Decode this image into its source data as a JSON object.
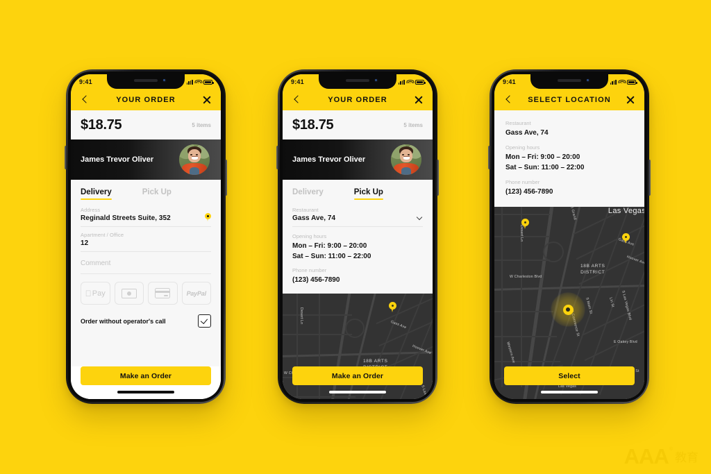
{
  "page": {
    "background_color": "#FDD30D",
    "watermark": {
      "brand": "AAA",
      "reg": "®",
      "cn": "教育"
    }
  },
  "status_bar": {
    "time": "9:41",
    "signal": "signal-icon",
    "wifi": "wifi-icon",
    "battery": "battery-icon"
  },
  "phone1": {
    "nav": {
      "title": "YOUR ORDER",
      "back": "chevron-left-icon",
      "close": "close-icon"
    },
    "total": {
      "amount": "$18.75",
      "items": "5 items"
    },
    "user": {
      "name": "James Trevor Oliver"
    },
    "tabs": [
      {
        "label": "Delivery",
        "active": true
      },
      {
        "label": "Pick Up",
        "active": false
      }
    ],
    "fields": {
      "address_label": "Address",
      "address_value": "Reginald Streets Suite, 352",
      "apartment_label": "Apartment / Office",
      "apartment_value": "12",
      "comment_placeholder": "Comment"
    },
    "payments": [
      {
        "name": "apple-pay",
        "label": "Pay",
        "mark": ""
      },
      {
        "name": "cash",
        "label": ""
      },
      {
        "name": "credit-card",
        "label": ""
      },
      {
        "name": "paypal",
        "label": "PayPal"
      }
    ],
    "option": {
      "label": "Order without operator's call",
      "checked": true
    },
    "cta": "Make an Order"
  },
  "phone2": {
    "nav": {
      "title": "YOUR ORDER",
      "back": "chevron-left-icon",
      "close": "close-icon"
    },
    "total": {
      "amount": "$18.75",
      "items": "5 items"
    },
    "user": {
      "name": "James Trevor Oliver"
    },
    "tabs": [
      {
        "label": "Delivery",
        "active": false
      },
      {
        "label": "Pick Up",
        "active": true
      }
    ],
    "info": {
      "restaurant_label": "Restaurant",
      "restaurant_value": "Gass Ave, 74",
      "hours_label": "Opening hours",
      "hours_weekday": "Mon – Fri: 9:00 – 20:00",
      "hours_weekend": "Sat – Sun: 11:00 – 22:00",
      "phone_label": "Phone number",
      "phone_value": "(123) 456-7890"
    },
    "cta": "Make an Order"
  },
  "phone3": {
    "nav": {
      "title": "SELECT LOCATION",
      "back": "chevron-left-icon",
      "close": "close-icon"
    },
    "info": {
      "restaurant_label": "Restaurant",
      "restaurant_value": "Gass Ave, 74",
      "hours_label": "Opening hours",
      "hours_weekday": "Mon – Fri: 9:00 – 20:00",
      "hours_weekend": "Sat – Sun: 11:00 – 22:00",
      "phone_label": "Phone number",
      "phone_value": "(123) 456-7890"
    },
    "cta": "Select"
  },
  "map": {
    "city": "Las Vegas",
    "district": "18B ARTS\nDISTRICT",
    "streets": {
      "charleston": "W Charleston Blvd",
      "desert": "Desert Ln",
      "gass": "Gass Ave",
      "hoover": "Hoover Ave",
      "main": "S Main St",
      "commerce": "S Commerce St",
      "lvblvd": "S Las Vegas Blvd",
      "grand": "S Grand",
      "lin": "Lin St",
      "western": "Western Ave",
      "oakey": "E Oakey Blvd",
      "est": "E St",
      "lasvegas_small": "Las Vegas"
    },
    "pins": 2,
    "selected_marker": "selected-location-marker"
  }
}
